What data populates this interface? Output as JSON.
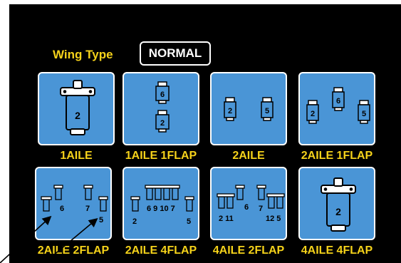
{
  "header": {
    "wing_type_label": "Wing Type",
    "selected_mode": "NORMAL"
  },
  "tiles": [
    {
      "label": "1AILE",
      "servos": [
        "2"
      ]
    },
    {
      "label": "1AILE 1FLAP",
      "servos": [
        "6",
        "2"
      ]
    },
    {
      "label": "2AILE",
      "servos": [
        "2",
        "5"
      ]
    },
    {
      "label": "2AILE 1FLAP",
      "servos": [
        "2",
        "6",
        "5"
      ]
    },
    {
      "label": "2AILE 2FLAP",
      "servos": [
        "6",
        "7",
        "5"
      ]
    },
    {
      "label": "2AILE 4FLAP",
      "servos": [
        "6 9 10 7",
        "2",
        "5"
      ]
    },
    {
      "label": "4AILE 2FLAP",
      "servos": [
        "6",
        "2 11",
        "7",
        "12 5"
      ]
    },
    {
      "label": "4AILE 4FLAP",
      "servos": [
        "2"
      ]
    }
  ],
  "colors": {
    "background": "#000000",
    "tile": "#4a95d6",
    "label": "#f5d21a",
    "border": "#ffffff"
  },
  "icons": [
    "servo-icon",
    "pointer-arrow-icon"
  ]
}
